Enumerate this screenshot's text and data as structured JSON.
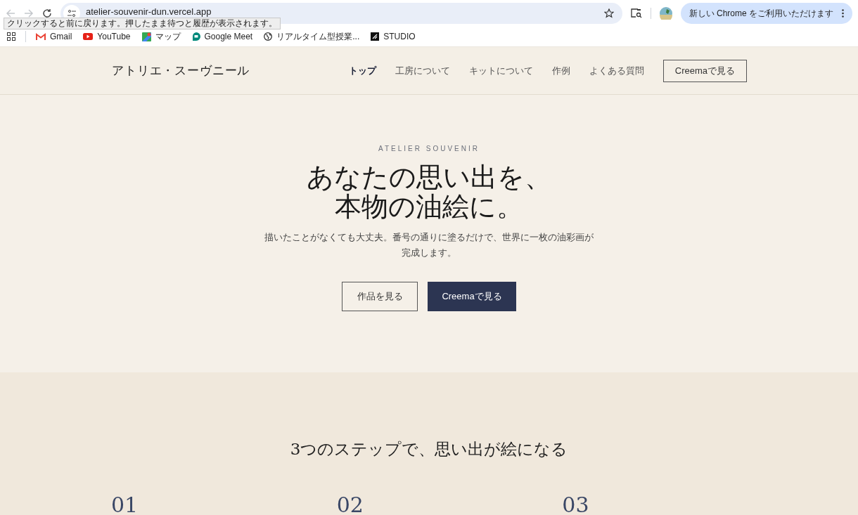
{
  "browser": {
    "url": "atelier-souvenir-dun.vercel.app",
    "back_disabled": true,
    "forward_disabled": true,
    "tooltip": "クリックすると前に戻ります。押したまま待つと履歴が表示されます。",
    "update_button": "新しい Chrome をご利用いただけます",
    "bookmarks": [
      {
        "kind": "gmail",
        "label": "Gmail"
      },
      {
        "kind": "youtube",
        "label": "YouTube"
      },
      {
        "kind": "maps",
        "label": "マップ"
      },
      {
        "kind": "meet",
        "label": "Google Meet"
      },
      {
        "kind": "globe",
        "label": "リアルタイム型授業..."
      },
      {
        "kind": "studio",
        "label": "STUDIO"
      }
    ]
  },
  "header": {
    "logo": "アトリエ・スーヴニール",
    "nav": [
      {
        "label": "トップ",
        "selected": true
      },
      {
        "label": "工房について",
        "selected": false
      },
      {
        "label": "キットについて",
        "selected": false
      },
      {
        "label": "作例",
        "selected": false
      },
      {
        "label": "よくある質問",
        "selected": false
      }
    ],
    "cta": "Creemaで見る"
  },
  "hero": {
    "eyebrow": "ATELIER SOUVENIR",
    "title_lines": [
      "あなたの思い出を、",
      "本物の油絵に。"
    ],
    "lead_lines": [
      "描いたことがなくても大丈夫。番号の通りに塗るだけで、世界に一枚の油彩画が",
      "完成します。"
    ],
    "buttons": [
      {
        "kind": "outline",
        "label": "作品を見る"
      },
      {
        "kind": "solid",
        "label": "Creemaで見る"
      }
    ]
  },
  "steps": {
    "title": "3つのステップで、思い出が絵になる",
    "numbers": [
      "01",
      "02",
      "03"
    ]
  }
}
